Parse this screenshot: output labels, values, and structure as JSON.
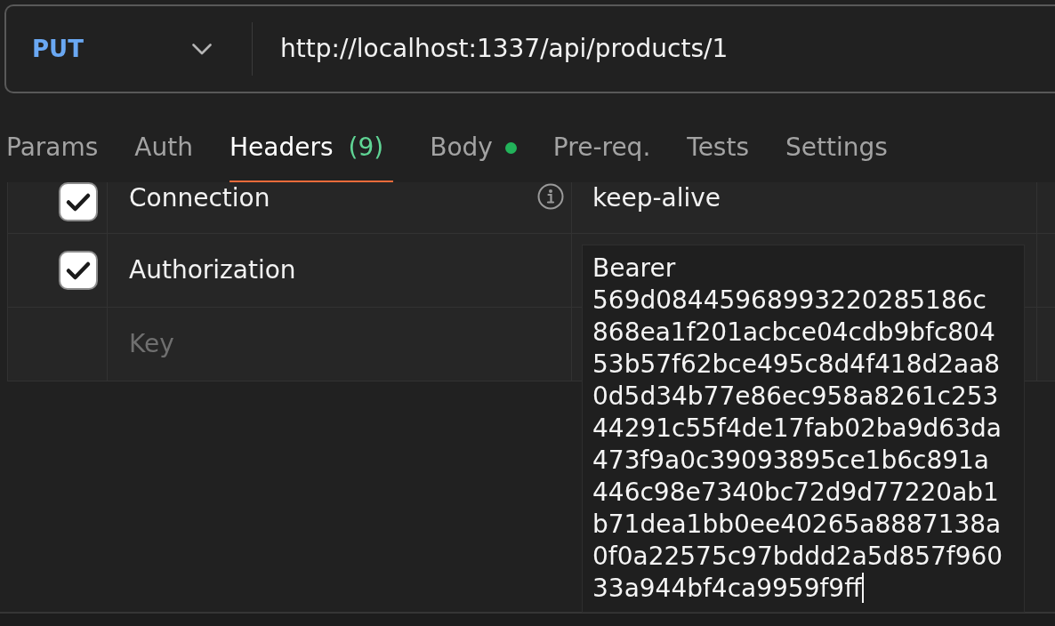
{
  "request": {
    "method": "PUT",
    "url": "http://localhost:1337/api/products/1"
  },
  "tabs": [
    {
      "label": "Params",
      "selected": false,
      "has_content": false
    },
    {
      "label": "Auth",
      "selected": false,
      "has_content": false
    },
    {
      "label": "Headers",
      "count": "(9)",
      "selected": true,
      "has_content": false
    },
    {
      "label": "Body",
      "selected": false,
      "has_content": true
    },
    {
      "label": "Pre-req.",
      "selected": false,
      "has_content": false
    },
    {
      "label": "Tests",
      "selected": false,
      "has_content": false
    },
    {
      "label": "Settings",
      "selected": false,
      "has_content": false
    }
  ],
  "headers": [
    {
      "kind": "entry",
      "checked": true,
      "key": "Connection",
      "info": true,
      "editing": false,
      "value_lines": [
        "keep-alive"
      ]
    },
    {
      "kind": "entry",
      "checked": true,
      "key": "Authorization",
      "info": false,
      "editing": true,
      "value_lines": [
        "Bearer",
        "569d08445968993220285186c",
        "868ea1f201acbce04cdb9bfc804",
        "53b57f62bce495c8d4f418d2aa8",
        "0d5d34b77e86ec958a8261c253",
        "44291c55f4de17fab02ba9d63da",
        "473f9a0c39093895ce1b6c891a",
        "446c98e7340bc72d9d77220ab1",
        "b71dea1bb0ee40265a8887138a",
        "0f0a22575c97bddd2a5d857f960",
        "33a944bf4ca9959f9ff"
      ]
    },
    {
      "kind": "empty",
      "key_placeholder": "Key"
    }
  ]
}
